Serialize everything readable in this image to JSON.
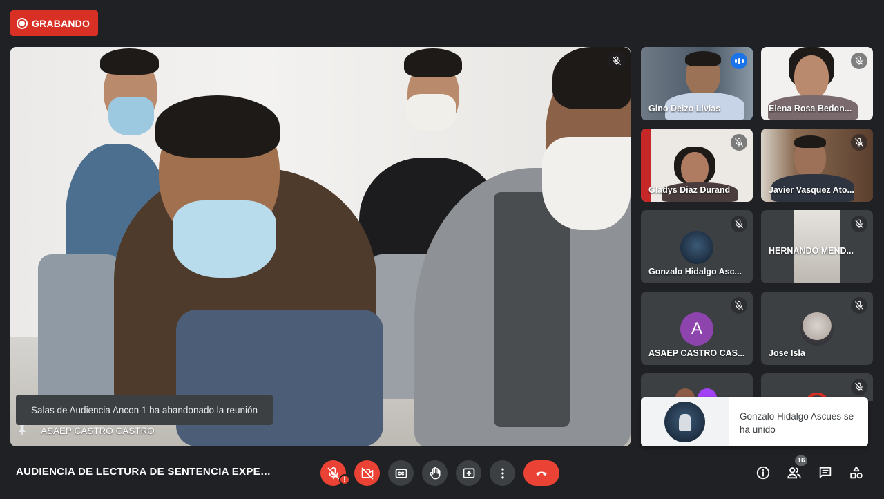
{
  "recording": {
    "label": "GRABANDO"
  },
  "main_video": {
    "participant_name": "ASAEP CASTRO CASTRO",
    "toast": "Salas de Audiencia Ancon 1 ha abandonado la reunión"
  },
  "tiles": [
    {
      "name": "Gino Delzo Livias",
      "speaking": true
    },
    {
      "name": "Elena Rosa Bedon..."
    },
    {
      "name": "Gladys Diaz Durand"
    },
    {
      "name": "Javier Vasquez Ato..."
    },
    {
      "name": "Gonzalo Hidalgo Asc..."
    },
    {
      "name": "HERNANDO MEND..."
    },
    {
      "name": "ASAEP CASTRO CAS...",
      "avatar_letter": "A"
    },
    {
      "name": "Jose Isla"
    }
  ],
  "notification": {
    "text": "Gonzalo Hidalgo Ascues se ha unido"
  },
  "bottom_bar": {
    "meeting_title": "AUDIENCIA DE LECTURA DE SENTENCIA EXPEDIEN...",
    "participants_count": "16",
    "warning_glyph": "!"
  },
  "icons": [
    "mic-off-icon",
    "camera-off-icon",
    "captions-icon",
    "raise-hand-icon",
    "present-icon",
    "more-icon",
    "hang-up-icon",
    "info-icon",
    "people-icon",
    "chat-icon",
    "activities-icon",
    "pin-icon"
  ],
  "colors": {
    "background": "#202124",
    "accent_red": "#ea4335",
    "recording_red": "#d93025",
    "speaking_blue": "#1a73e8"
  }
}
